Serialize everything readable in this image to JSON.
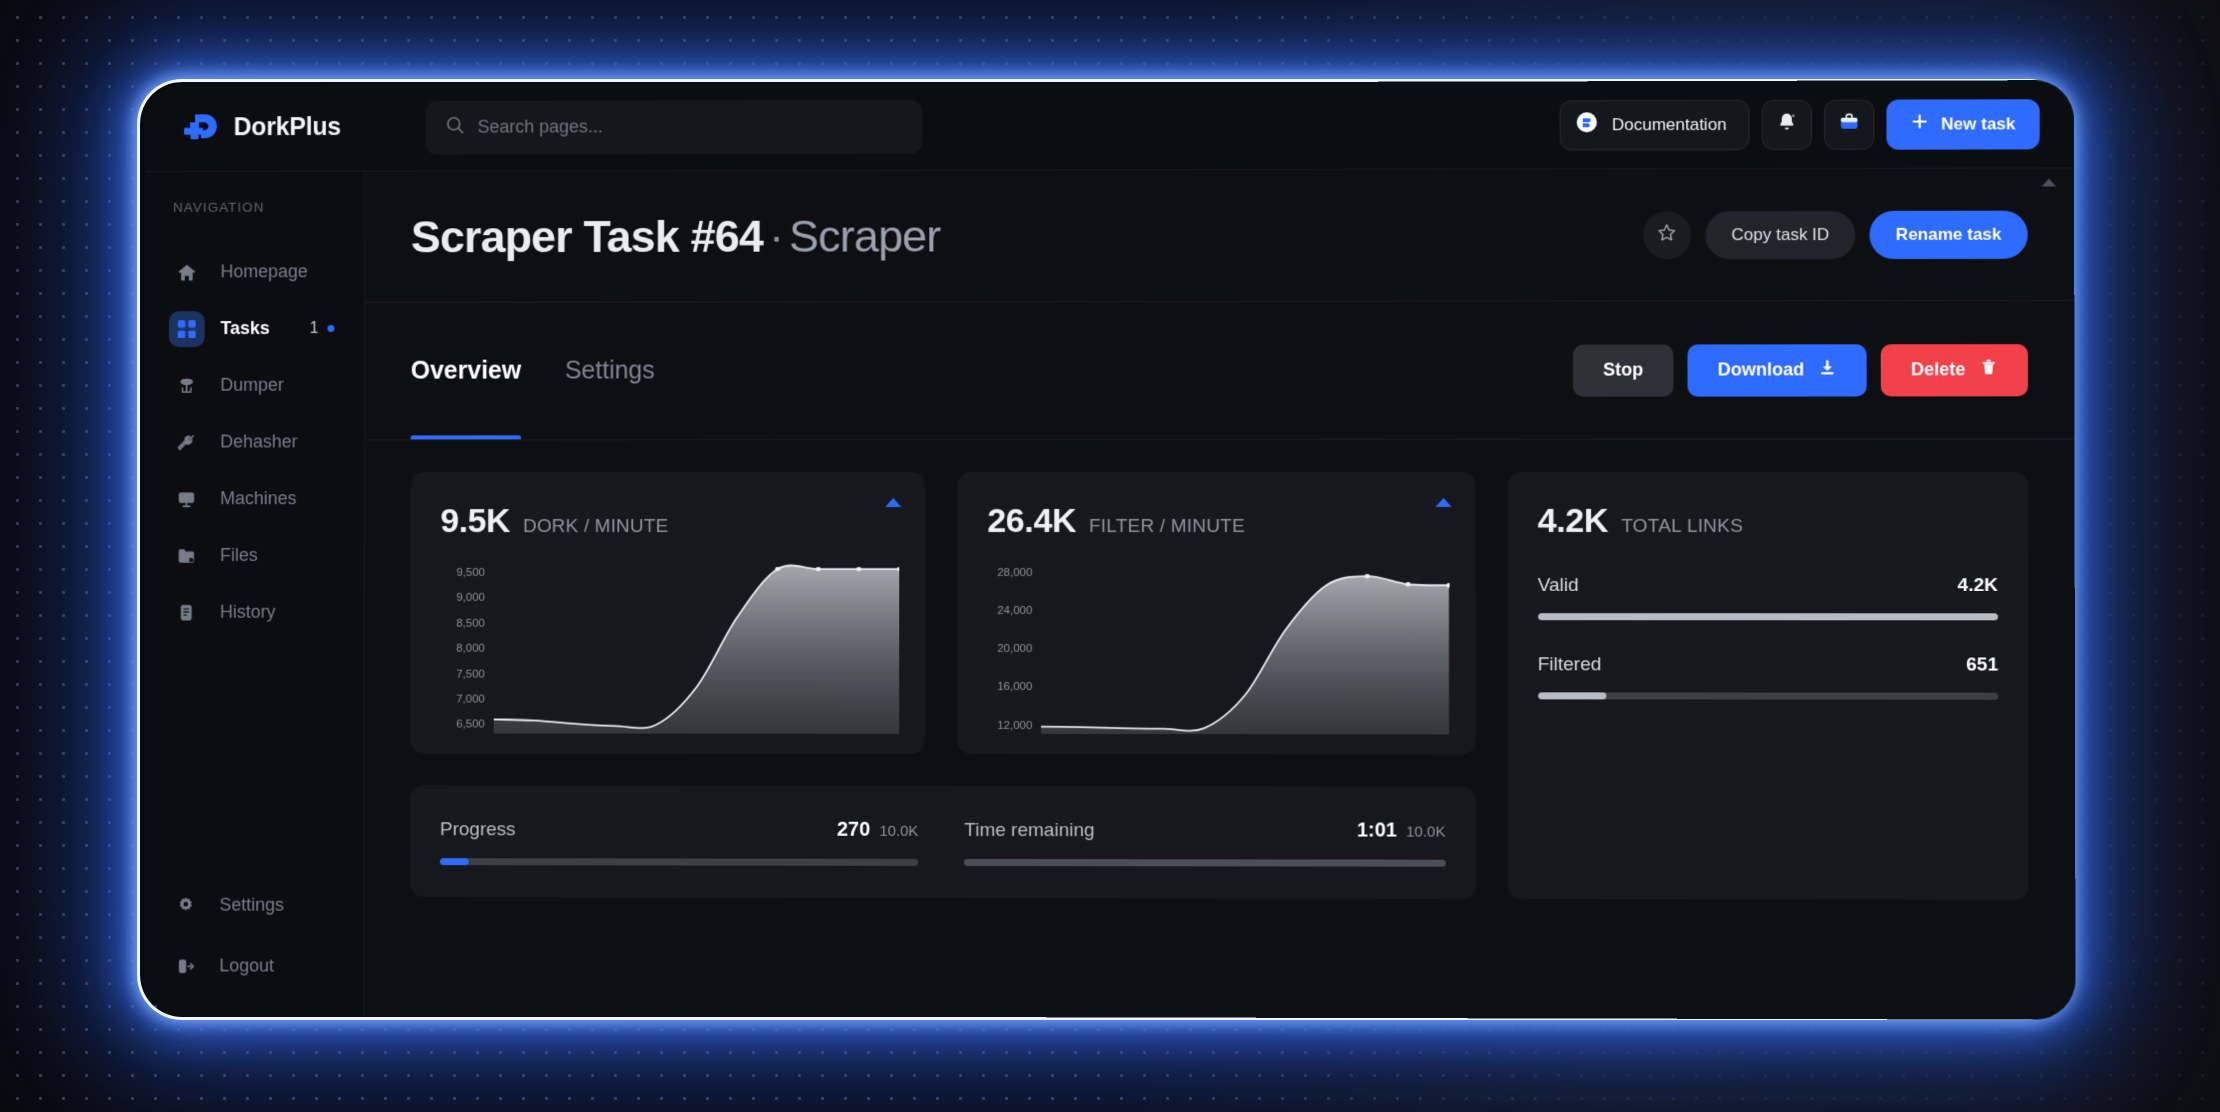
{
  "brand": {
    "name": "DorkPlus",
    "logo_icon": "dorkplus-logo-icon",
    "accent": "#2f6bff"
  },
  "search": {
    "placeholder": "Search pages...",
    "value": "",
    "icon": "search-icon"
  },
  "topbar": {
    "documentation_label": "Documentation",
    "documentation_icon": "book-circle-icon",
    "notifications_icon": "bell-icon",
    "briefcase_icon": "briefcase-icon",
    "new_task_label": "New task",
    "new_task_icon": "plus-icon"
  },
  "sidebar": {
    "section_title": "NAVIGATION",
    "items": [
      {
        "label": "Homepage",
        "icon": "home-icon",
        "active": false,
        "badge": ""
      },
      {
        "label": "Tasks",
        "icon": "grid-icon",
        "active": true,
        "badge": "1"
      },
      {
        "label": "Dumper",
        "icon": "database-tree-icon",
        "active": false,
        "badge": ""
      },
      {
        "label": "Dehasher",
        "icon": "key-icon",
        "active": false,
        "badge": ""
      },
      {
        "label": "Machines",
        "icon": "monitor-icon",
        "active": false,
        "badge": ""
      },
      {
        "label": "Files",
        "icon": "folder-icon",
        "active": false,
        "badge": ""
      },
      {
        "label": "History",
        "icon": "document-icon",
        "active": false,
        "badge": ""
      }
    ],
    "bottom_items": [
      {
        "label": "Settings",
        "icon": "gear-icon"
      },
      {
        "label": "Logout",
        "icon": "logout-icon"
      }
    ]
  },
  "page": {
    "title": "Scraper Task #64",
    "separator": "·",
    "subtitle": "Scraper",
    "favorite_icon": "star-icon",
    "copy_task_id_label": "Copy task ID",
    "rename_task_label": "Rename task"
  },
  "tabs": [
    {
      "label": "Overview",
      "active": true
    },
    {
      "label": "Settings",
      "active": false
    }
  ],
  "task_actions": {
    "stop_label": "Stop",
    "download_label": "Download",
    "download_icon": "download-icon",
    "delete_label": "Delete",
    "delete_icon": "trash-icon",
    "stop_color": "#2e3038",
    "download_color": "#2f6bff",
    "delete_color": "#f2414b"
  },
  "cards": {
    "dork": {
      "value": "9.5K",
      "caption": "DORK / MINUTE",
      "trend_icon": "triangle-up-icon"
    },
    "filter": {
      "value": "26.4K",
      "caption": "FILTER / MINUTE",
      "trend_icon": "triangle-up-icon"
    },
    "total_links": {
      "value": "4.2K",
      "caption": "TOTAL LINKS",
      "rows": [
        {
          "name": "Valid",
          "value": "4.2K",
          "percent": 100
        },
        {
          "name": "Filtered",
          "value": "651",
          "percent": 15
        }
      ]
    }
  },
  "progress_panel": {
    "progress": {
      "label": "Progress",
      "value": "270",
      "total": "10.0K",
      "percent": 6
    },
    "time_remaining": {
      "label": "Time remaining",
      "value": "1:01",
      "total": "10.0K",
      "percent": 100
    }
  },
  "chart_data": [
    {
      "type": "area",
      "title": "DORK / MINUTE",
      "headline_value": "9.5K",
      "xlabel": "",
      "ylabel": "",
      "ylim": [
        6500,
        9500
      ],
      "grid": false,
      "legend": "none",
      "ticks": [
        "9,500",
        "9,000",
        "8,500",
        "8,000",
        "7,500",
        "7,000",
        "6,500"
      ],
      "x": [
        0,
        1,
        2,
        3,
        4,
        5,
        6,
        7,
        8,
        9,
        10
      ],
      "values": [
        6700,
        6680,
        6620,
        6580,
        6600,
        7300,
        8600,
        9500,
        9500,
        9500,
        9500
      ],
      "markers": [
        7,
        8,
        9,
        10
      ]
    },
    {
      "type": "area",
      "title": "FILTER / MINUTE",
      "headline_value": "26.4K",
      "xlabel": "",
      "ylabel": "",
      "ylim": [
        12000,
        28000
      ],
      "grid": false,
      "legend": "none",
      "ticks": [
        "28,000",
        "24,000",
        "20,000",
        "16,000",
        "12,000"
      ],
      "x": [
        0,
        1,
        2,
        3,
        4,
        5,
        6,
        7,
        8,
        9,
        10
      ],
      "values": [
        12400,
        12350,
        12250,
        12200,
        12250,
        15500,
        22000,
        26400,
        27300,
        26500,
        26400
      ],
      "markers": [
        8,
        9,
        10
      ]
    }
  ]
}
